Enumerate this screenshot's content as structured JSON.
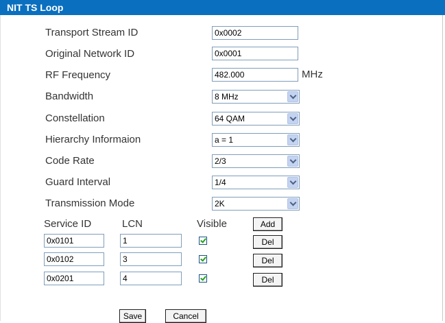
{
  "window": {
    "title": "NIT TS Loop"
  },
  "fields": {
    "transport_stream_id": {
      "label": "Transport Stream ID",
      "value": "0x0002"
    },
    "original_network_id": {
      "label": "Original Network ID",
      "value": "0x0001"
    },
    "rf_frequency": {
      "label": "RF Frequency",
      "value": "482.000",
      "unit": "MHz"
    },
    "bandwidth": {
      "label": "Bandwidth",
      "value": "8 MHz"
    },
    "constellation": {
      "label": "Constellation",
      "value": "64 QAM"
    },
    "hierarchy": {
      "label": "Hierarchy Informaion",
      "value": "a = 1"
    },
    "code_rate": {
      "label": "Code Rate",
      "value": "2/3"
    },
    "guard_interval": {
      "label": "Guard Interval",
      "value": "1/4"
    },
    "transmission_mode": {
      "label": "Transmission Mode",
      "value": "2K"
    }
  },
  "services": {
    "headers": {
      "service_id": "Service ID",
      "lcn": "LCN",
      "visible": "Visible"
    },
    "add_label": "Add",
    "del_label": "Del",
    "rows": [
      {
        "service_id": "0x0101",
        "lcn": "1",
        "visible": true
      },
      {
        "service_id": "0x0102",
        "lcn": "3",
        "visible": true
      },
      {
        "service_id": "0x0201",
        "lcn": "4",
        "visible": true
      }
    ]
  },
  "actions": {
    "save_label": "Save",
    "cancel_label": "Cancel"
  },
  "colors": {
    "titlebar": "#0a6fbf",
    "checkmark": "#21a121"
  }
}
